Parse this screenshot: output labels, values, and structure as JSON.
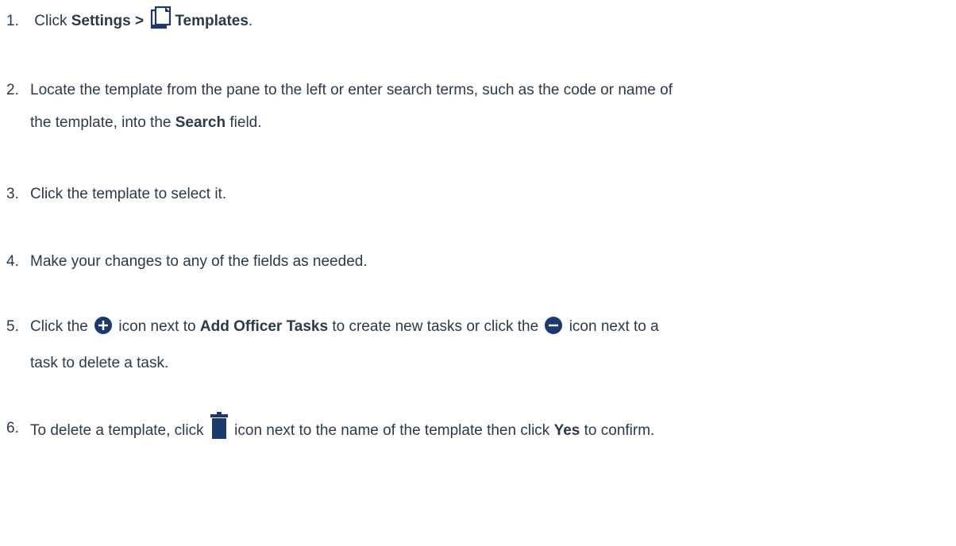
{
  "steps": [
    {
      "number": "1.",
      "prefix": "Click ",
      "bold1": "Settings >",
      "bold2": "Templates",
      "suffix": ".",
      "icon": "templates-icon"
    },
    {
      "number": "2.",
      "line1": "Locate the template from the pane to the left or enter search terms, such as the code or name of",
      "line2_prefix": "the template, into the ",
      "bold": "Search",
      "line2_suffix": " field."
    },
    {
      "number": "3.",
      "text": "Click the template to select it."
    },
    {
      "number": "4.",
      "text": "Make your changes to any of the fields as needed."
    },
    {
      "number": "5.",
      "prefix": "Click the ",
      "mid1": " icon next to ",
      "bold": "Add Officer Tasks",
      "mid2": " to create new tasks or click the ",
      "suffix": " icon next to a",
      "line2": "task to delete a task.",
      "icon_add": "add-circle-icon",
      "icon_remove": "remove-circle-icon"
    },
    {
      "number": "6.",
      "prefix": "To delete a template, click ",
      "mid": " icon next to the name of the template then click ",
      "bold": "Yes",
      "suffix": " to confirm.",
      "icon": "trash-icon"
    }
  ],
  "colors": {
    "text": "#2b3a4a",
    "icon": "#1b3a6b"
  }
}
